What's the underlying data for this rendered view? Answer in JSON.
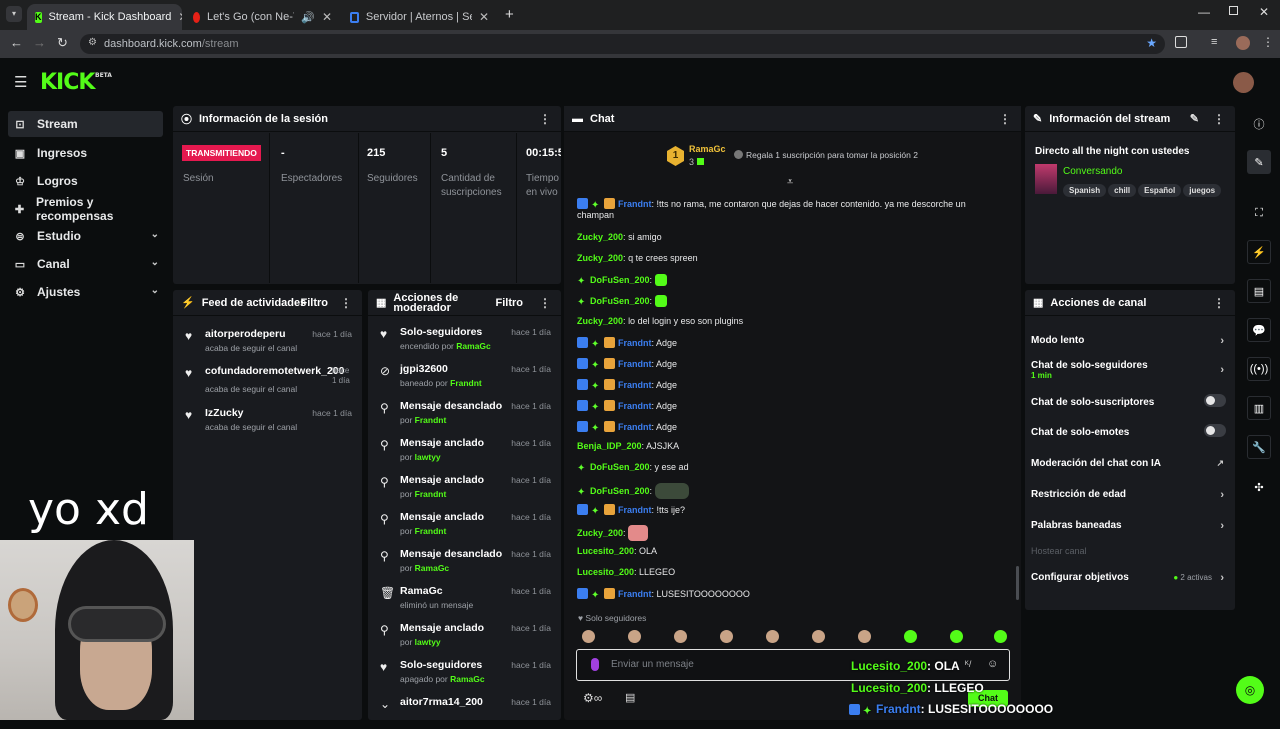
{
  "browser": {
    "tabs": [
      {
        "title": "Stream - Kick Dashboard"
      },
      {
        "title": "Let's Go (con Ne-Yo) - YouT"
      },
      {
        "title": "Servidor | Aternos | Servidor de"
      }
    ],
    "url_domain": "dashboard.kick.com",
    "url_path": "/stream"
  },
  "site": {
    "logo": "KICK",
    "logo_badge": "BETA"
  },
  "sidebar": {
    "items": [
      {
        "label": "Stream",
        "icon": "cast-icon"
      },
      {
        "label": "Ingresos",
        "icon": "money-icon"
      },
      {
        "label": "Logros",
        "icon": "trophy-icon"
      },
      {
        "label": "Premios y recompensas",
        "icon": "gift-icon"
      },
      {
        "label": "Estudio",
        "icon": "studio-icon"
      },
      {
        "label": "Canal",
        "icon": "channel-icon"
      },
      {
        "label": "Ajustes",
        "icon": "gear-icon"
      }
    ]
  },
  "session": {
    "title": "Información de la sesión",
    "status_badge": "TRANSMITIENDO",
    "status_label": "Sesión",
    "stats": [
      {
        "value": "-",
        "label": "Espectadores"
      },
      {
        "value": "215",
        "label": "Seguidores"
      },
      {
        "value": "5",
        "label": "Cantidad de suscripciones"
      },
      {
        "value": "00:15:5",
        "label": "Tiempo en vivo"
      }
    ]
  },
  "activity": {
    "title": "Feed de actividades",
    "filter": "Filtro",
    "items": [
      {
        "user": "aitorperodeperu",
        "sub": "acaba de seguir el canal",
        "time": "hace 1 día"
      },
      {
        "user": "cofundadoremotetwerk_200",
        "sub": "acaba de seguir el canal",
        "time": "hace 1 día"
      },
      {
        "user": "IzZucky",
        "sub": "acaba de seguir el canal",
        "time": "hace 1 día"
      }
    ]
  },
  "moderation": {
    "title": "Acciones de moderador",
    "filter": "Filtro",
    "items": [
      {
        "action": "Solo-seguidores",
        "prefix": "encendido por",
        "by": "RamaGc",
        "time": "hace 1 día"
      },
      {
        "action": "jgpi32600",
        "prefix": "baneado por",
        "by": "Frandnt",
        "time": "hace 1 día"
      },
      {
        "action": "Mensaje desanclado",
        "prefix": "por",
        "by": "Frandnt",
        "time": "hace 1 día"
      },
      {
        "action": "Mensaje anclado",
        "prefix": "por",
        "by": "lawtyy",
        "time": "hace 1 día"
      },
      {
        "action": "Mensaje anclado",
        "prefix": "por",
        "by": "Frandnt",
        "time": "hace 1 día"
      },
      {
        "action": "Mensaje anclado",
        "prefix": "por",
        "by": "Frandnt",
        "time": "hace 1 día"
      },
      {
        "action": "Mensaje desanclado",
        "prefix": "por",
        "by": "RamaGc",
        "time": "hace 1 día"
      },
      {
        "action": "RamaGc",
        "prefix": "eliminó un mensaje",
        "by": "",
        "time": "hace 1 día"
      },
      {
        "action": "Mensaje anclado",
        "prefix": "por",
        "by": "lawtyy",
        "time": "hace 1 día"
      },
      {
        "action": "Solo-seguidores",
        "prefix": "apagado por",
        "by": "RamaGc",
        "time": "hace 1 día"
      },
      {
        "action": "aitor7rma14_200",
        "prefix": "",
        "by": "",
        "time": "hace 1 día"
      }
    ]
  },
  "chat": {
    "title": "Chat",
    "top_gifter": {
      "name": "RamaGc",
      "count": "3",
      "rank": "1"
    },
    "gift_prompt": "Regala 1 suscripción para tomar la posición 2",
    "messages": [
      {
        "user": "Frandnt",
        "text": "!tts no rama, me contaron que dejas de hacer contenido. ya me descorche un",
        "cont": "champan"
      },
      {
        "user": "Zucky_200",
        "text": "si amigo"
      },
      {
        "user": "Zucky_200",
        "text": "q te crees spreen"
      },
      {
        "user": "DoFuSen_200",
        "text": ""
      },
      {
        "user": "DoFuSen_200",
        "text": ""
      },
      {
        "user": "Zucky_200",
        "text": "lo del login y eso son plugins"
      },
      {
        "user": "Frandnt",
        "text": "Adge"
      },
      {
        "user": "Frandnt",
        "text": "Adge"
      },
      {
        "user": "Frandnt",
        "text": "Adge"
      },
      {
        "user": "Frandnt",
        "text": "Adge"
      },
      {
        "user": "Frandnt",
        "text": "Adge"
      },
      {
        "user": "Benja_IDP_200",
        "text": "AJSJKA"
      },
      {
        "user": "DoFuSen_200",
        "text": "y ese ad"
      },
      {
        "user": "DoFuSen_200",
        "text": ""
      },
      {
        "user": "Frandnt",
        "text": "!tts ije?"
      },
      {
        "user": "Zucky_200",
        "text": ""
      },
      {
        "user": "Lucesito_200",
        "text": "OLA"
      },
      {
        "user": "Lucesito_200",
        "text": "LLEGEO"
      },
      {
        "user": "Frandnt",
        "text": "LUSESITOOOOOOOO"
      }
    ],
    "mode_label": "Solo seguidores",
    "input_placeholder": "Enviar un mensaje",
    "send_label": "Chat"
  },
  "stream_info": {
    "title": "Información del stream",
    "stream_title": "Directo all the night con ustedes",
    "category": "Conversando",
    "tags": [
      "Spanish",
      "chill",
      "Español",
      "juegos"
    ]
  },
  "channel_actions": {
    "title": "Acciones de canal",
    "items": [
      {
        "label": "Modo lento",
        "type": "arrow"
      },
      {
        "label": "Chat de solo-seguidores",
        "sub": "1 min",
        "type": "arrow"
      },
      {
        "label": "Chat de solo-suscriptores",
        "type": "toggle"
      },
      {
        "label": "Chat de solo-emotes",
        "type": "toggle"
      },
      {
        "label": "Moderación del chat con IA",
        "type": "external"
      },
      {
        "label": "Restricción de edad",
        "type": "arrow"
      },
      {
        "label": "Palabras baneadas",
        "type": "arrow"
      },
      {
        "label": "Hostear canal",
        "type": "disabled"
      },
      {
        "label": "Configurar objetivos",
        "extra": "2 activas",
        "type": "arrow"
      }
    ]
  },
  "overlay": {
    "caption": "yo xd",
    "lines": [
      {
        "user": "Lucesito_200",
        "text": ": OLA"
      },
      {
        "user": "Lucesito_200",
        "text": ": LLEGEO"
      },
      {
        "user": "Frandnt",
        "text": ": LUSESITOOOOOOOO"
      }
    ]
  },
  "colors": {
    "accent": "#53fc18",
    "live": "#e5194f",
    "panel": "#191b1f"
  }
}
